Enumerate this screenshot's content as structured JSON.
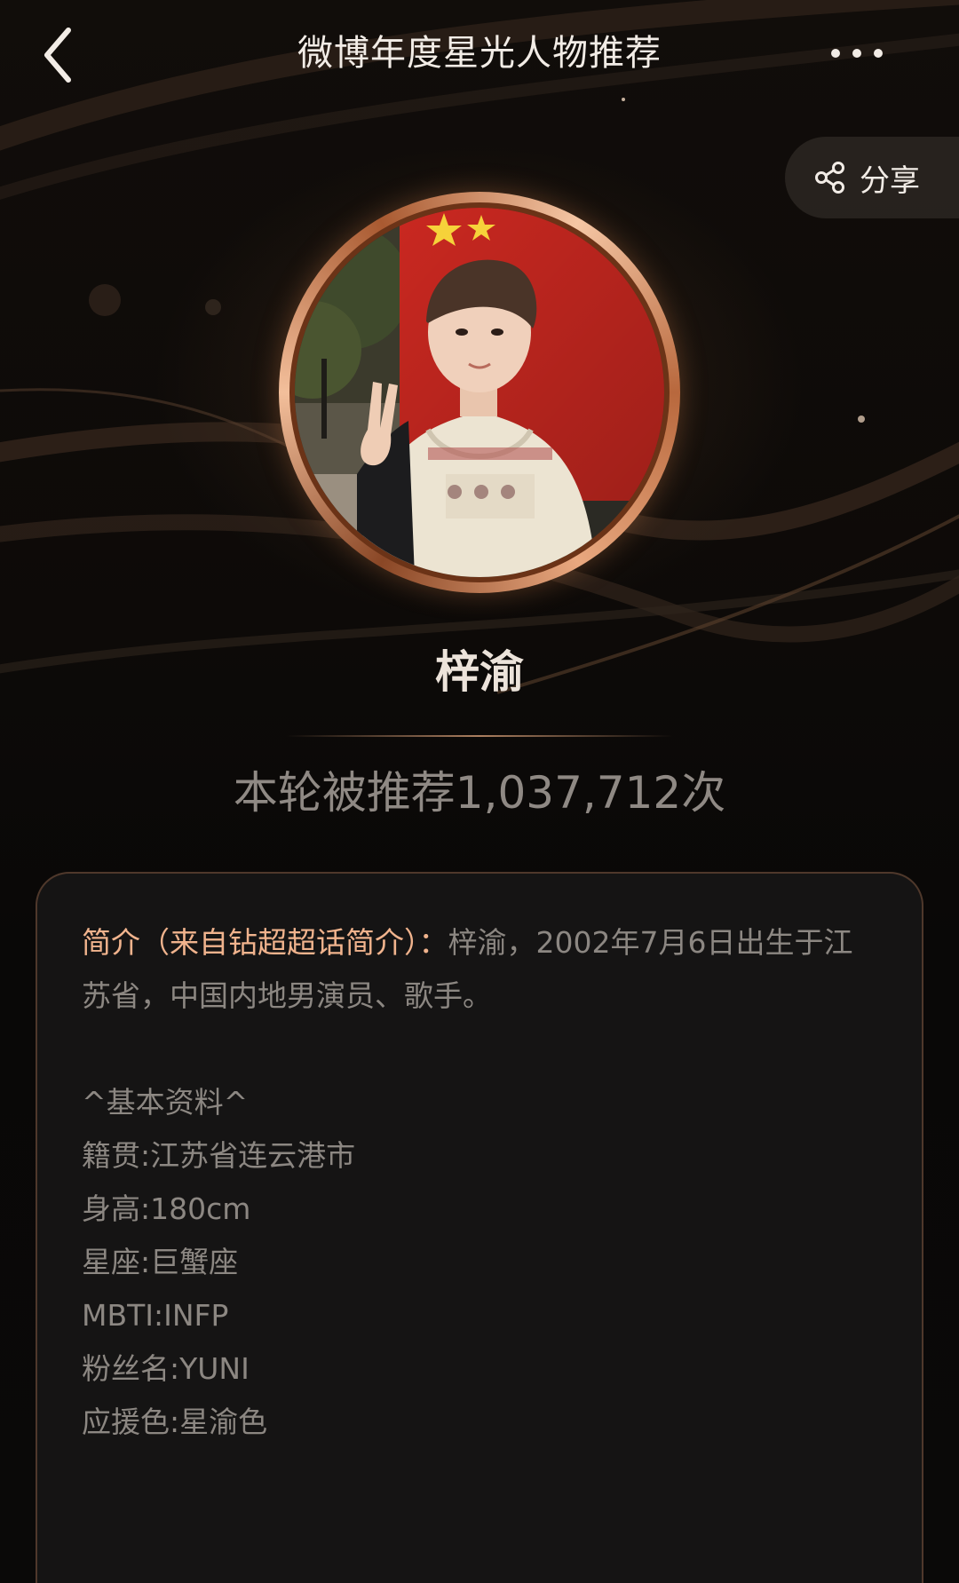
{
  "header": {
    "title": "微博年度星光人物推荐",
    "back_icon": "chevron-left-icon",
    "more_icon": "more-dots-icon"
  },
  "share": {
    "label": "分享",
    "icon": "share-nodes-icon"
  },
  "profile": {
    "name": "梓渝",
    "recommend_text": "本轮被推荐1,037,712次"
  },
  "intro": {
    "label": "简介（来自钻超超话简介）：",
    "text": "梓渝，2002年7月6日出生于江苏省，中国内地男演员、歌手。"
  },
  "facts": [
    "^基本资料^",
    "籍贯:江苏省连云港市",
    "身高:180cm",
    "星座:巨蟹座",
    "MBTI:INFP",
    "粉丝名:YUNI",
    "应援色:星渝色"
  ],
  "colors": {
    "accent_orange": "#f0b38d",
    "ring_copper": "#c8784a",
    "text_muted": "#8c8782"
  }
}
